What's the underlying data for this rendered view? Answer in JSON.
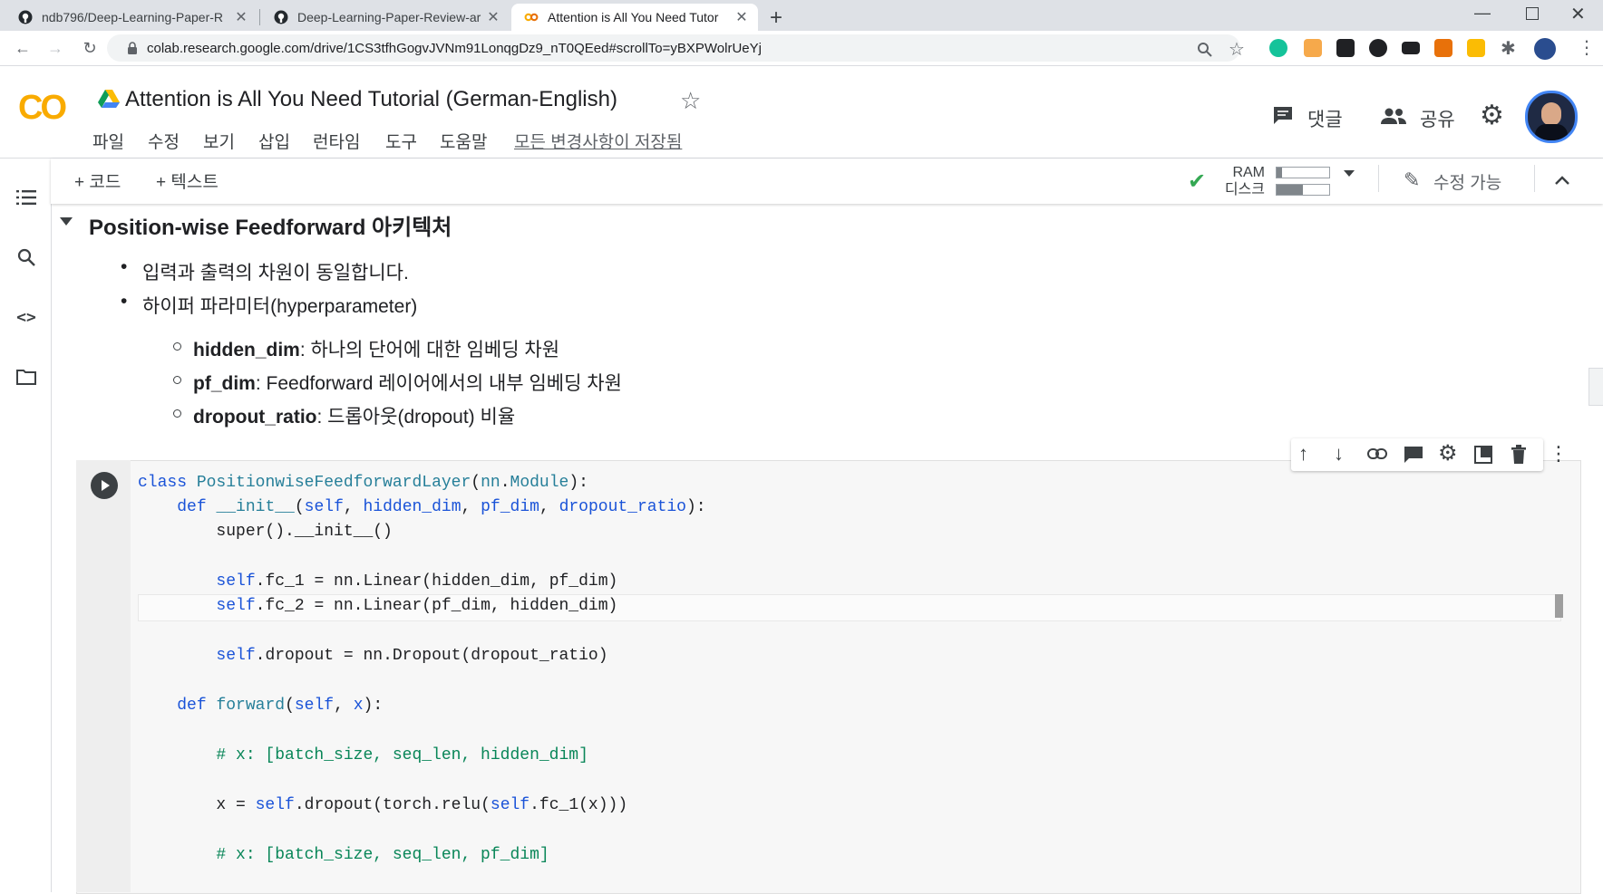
{
  "browser": {
    "tabs": [
      {
        "title": "ndb796/Deep-Learning-Paper-R"
      },
      {
        "title": "Deep-Learning-Paper-Review-ar"
      },
      {
        "title": "Attention is All You Need Tutor"
      }
    ],
    "url": "colab.research.google.com/drive/1CS3tfhGogvJVNm91LonqgDz9_nT0QEed#scrollTo=yBXPWolrUeYj"
  },
  "colab": {
    "logo": "CO",
    "title": "Attention is All You Need Tutorial (German-English)",
    "menu": [
      "파일",
      "수정",
      "보기",
      "삽입",
      "런타임",
      "도구",
      "도움말"
    ],
    "save_status": "모든 변경사항이 저장됨",
    "comment_label": "댓글",
    "share_label": "공유"
  },
  "toolbar": {
    "add_code": "+ 코드",
    "add_text": "+ 텍스트",
    "ram_label": "RAM",
    "disk_label": "디스크",
    "ram_fraction": 0.1,
    "disk_fraction": 0.5,
    "edit_mode": "수정 가능"
  },
  "section": {
    "heading": "Position-wise Feedforward 아키텍처",
    "bullets": [
      "입력과 출력의 차원이 동일합니다.",
      "하이퍼 파라미터(hyperparameter)"
    ],
    "params": [
      {
        "name": "hidden_dim",
        "desc": ": 하나의 단어에 대한 임베딩 차원"
      },
      {
        "name": "pf_dim",
        "desc": ": Feedforward 레이어에서의 내부 임베딩 차원"
      },
      {
        "name": "dropout_ratio",
        "desc": ": 드롭아웃(dropout) 비율"
      }
    ]
  },
  "code_lines": [
    "class PositionwiseFeedforwardLayer(nn.Module):",
    "    def __init__(self, hidden_dim, pf_dim, dropout_ratio):",
    "        super().__init__()",
    "",
    "        self.fc_1 = nn.Linear(hidden_dim, pf_dim)",
    "        self.fc_2 = nn.Linear(pf_dim, hidden_dim)",
    "",
    "        self.dropout = nn.Dropout(dropout_ratio)",
    "",
    "    def forward(self, x):",
    "",
    "        # x: [batch_size, seq_len, hidden_dim]",
    "",
    "        x = self.dropout(torch.relu(self.fc_1(x)))",
    "",
    "        # x: [batch_size, seq_len, pf_dim]"
  ]
}
